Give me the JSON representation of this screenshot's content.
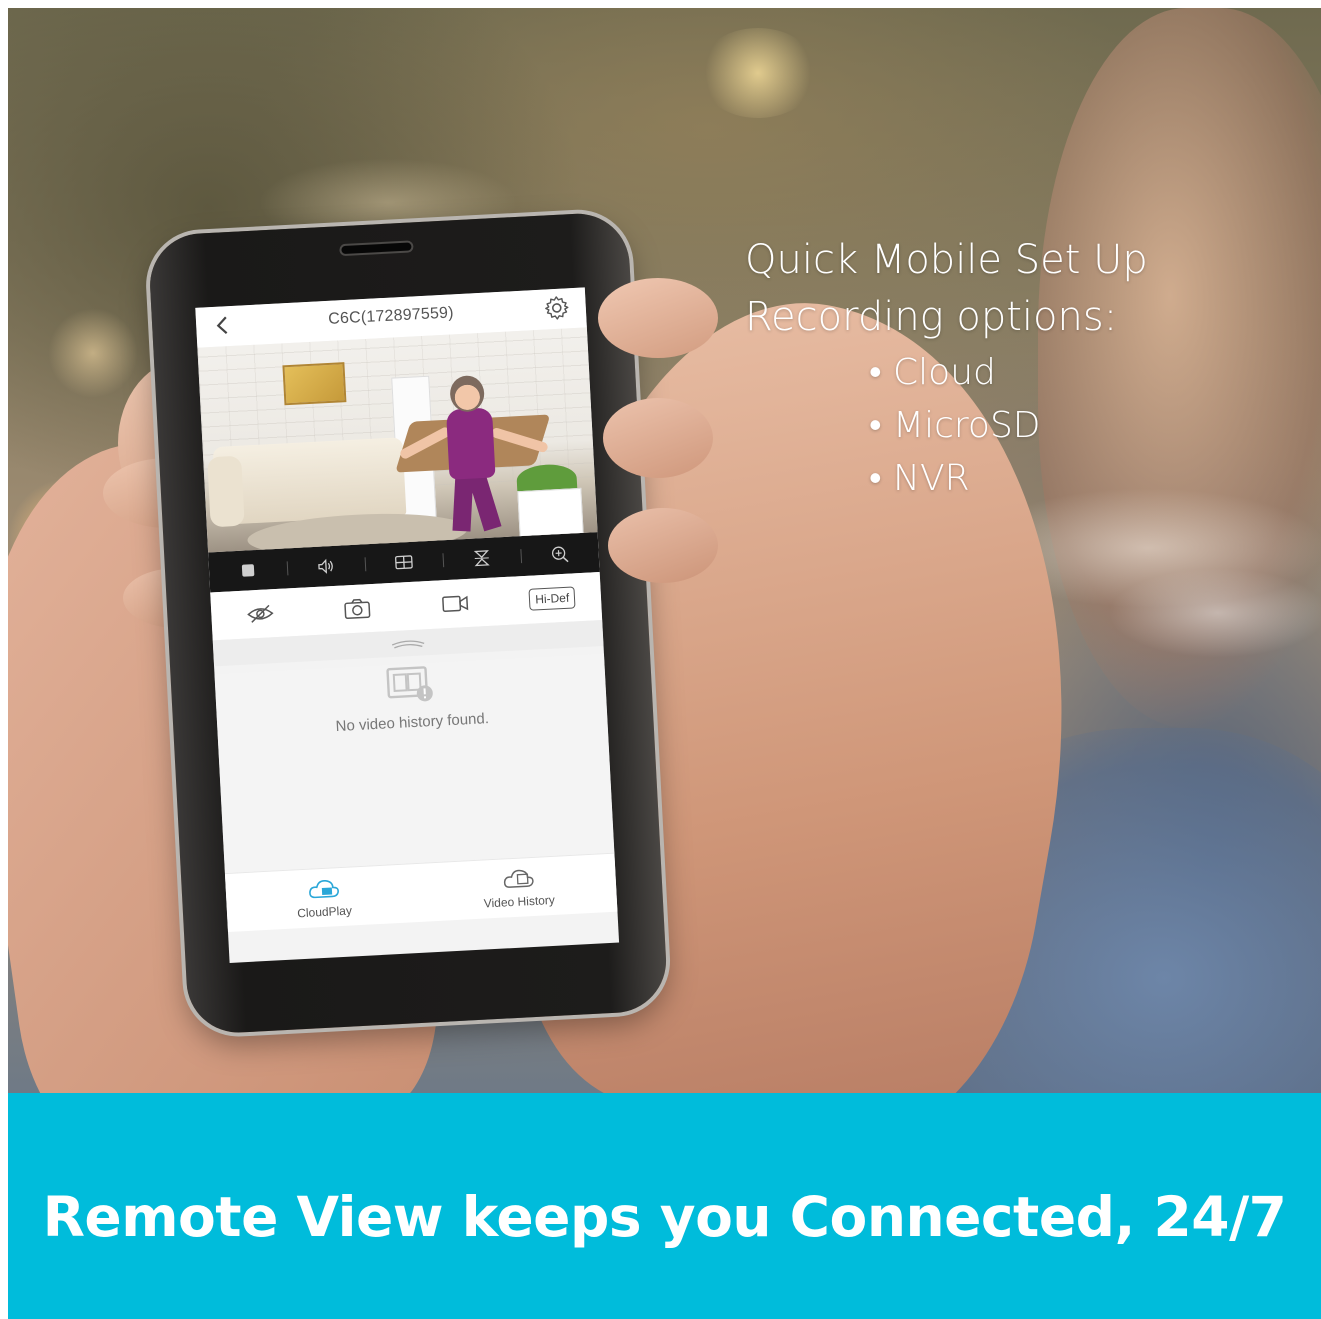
{
  "app": {
    "camera_title": "C6C(172897559)",
    "hidef_label": "Hi-Def",
    "empty_history_message": "No video history found.",
    "tabs": [
      {
        "label": "CloudPlay",
        "icon": "cloud-play-icon",
        "active": true
      },
      {
        "label": "Video History",
        "icon": "video-history-icon",
        "active": false
      }
    ],
    "control_bar_icons": [
      "stop-icon",
      "volume-icon",
      "grid-view-icon",
      "flip-icon",
      "zoom-in-icon"
    ],
    "action_bar_icons": [
      "privacy-eye-off-icon",
      "snapshot-camera-icon",
      "record-video-icon",
      "hidef-quality-button"
    ],
    "accent_color": "#2aa7d8"
  },
  "overlay": {
    "line1": "Quick Mobile Set Up",
    "line2": "Recording options:",
    "options": [
      "Cloud",
      "MicroSD",
      "NVR"
    ]
  },
  "banner": {
    "text": "Remote View keeps you Connected, 24/7",
    "color": "#00bcdb"
  }
}
